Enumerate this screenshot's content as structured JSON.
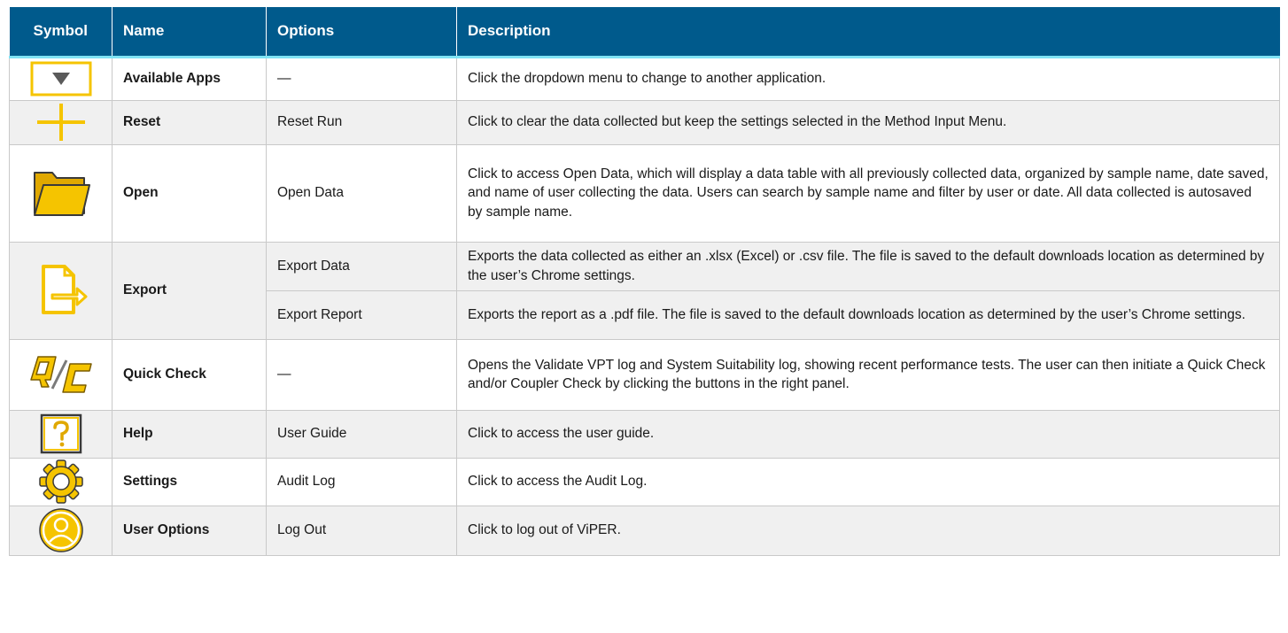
{
  "colors": {
    "header_bg": "#005a8c",
    "header_rule": "#7fe3f5",
    "accent_gold": "#f5c400",
    "row_alt": "#f0f0f0"
  },
  "header": {
    "symbol": "Symbol",
    "name": "Name",
    "options": "Options",
    "description": "Description"
  },
  "rows": [
    {
      "icon": "dropdown-arrow-icon",
      "name": "Available Apps",
      "options": "—",
      "description": "Click the dropdown menu to change to another application."
    },
    {
      "icon": "plus-icon",
      "name": "Reset",
      "options": "Reset Run",
      "description": "Click to clear the data collected but keep the settings selected in the Method Input Menu."
    },
    {
      "icon": "folder-icon",
      "name": "Open",
      "options": "Open Data",
      "description": "Click to access Open Data, which will display a data table with all previously collected data, organized by sample name, date saved, and name of user collecting the data. Users can search by sample name and filter by user or date. All data collected is autosaved by sample name."
    },
    {
      "icon": "export-icon",
      "name": "Export",
      "sub": [
        {
          "options": "Export Data",
          "description": "Exports the data collected as either an .xlsx (Excel) or .csv file. The file is saved to the default downloads location as determined by the user’s Chrome settings."
        },
        {
          "options": "Export Report",
          "description": "Exports the report as a .pdf file. The file is saved to the default downloads location as determined by the user’s Chrome settings."
        }
      ]
    },
    {
      "icon": "quick-check-icon",
      "name": "Quick Check",
      "options": "—",
      "description": "Opens the Validate VPT log and System Suitability log, showing recent performance tests. The user can then initiate a Quick Check and/or Coupler Check by clicking the buttons in the right panel."
    },
    {
      "icon": "help-icon",
      "name": "Help",
      "options": "User Guide",
      "description": "Click to access the user guide."
    },
    {
      "icon": "gear-icon",
      "name": "Settings",
      "options": "Audit Log",
      "description": "Click to access the Audit Log."
    },
    {
      "icon": "user-icon",
      "name": "User Options",
      "options": "Log Out",
      "description": "Click to log out of ViPER."
    }
  ]
}
